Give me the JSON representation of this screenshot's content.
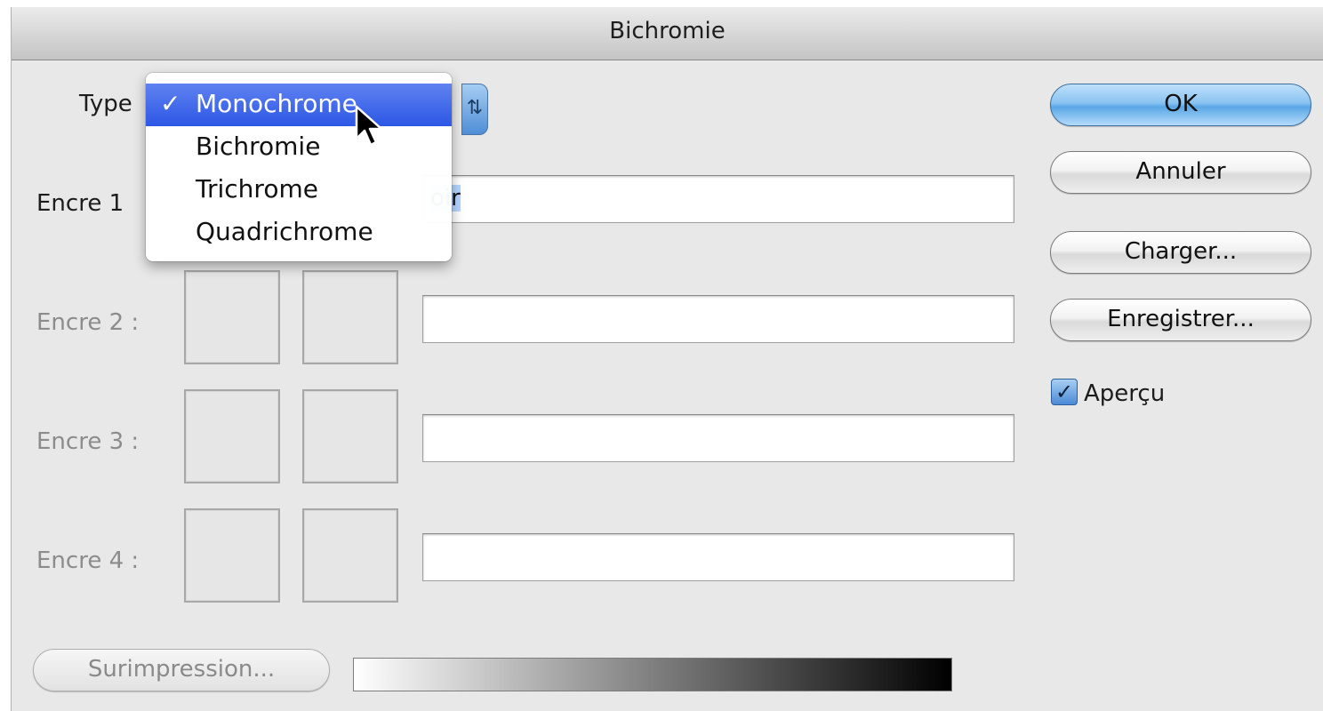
{
  "window": {
    "title": "Bichromie"
  },
  "type_field": {
    "label": "Type",
    "options": [
      "Monochrome",
      "Bichromie",
      "Trichrome",
      "Quadrichrome"
    ],
    "selected": "Monochrome",
    "check_mark": "✓",
    "stepper_symbol": "⇅"
  },
  "inks": [
    {
      "label": "Encre 1",
      "value_visible": "oir",
      "enabled": true
    },
    {
      "label": "Encre 2 :",
      "value_visible": "",
      "enabled": false
    },
    {
      "label": "Encre 3 :",
      "value_visible": "",
      "enabled": false
    },
    {
      "label": "Encre 4 :",
      "value_visible": "",
      "enabled": false
    }
  ],
  "buttons": {
    "ok": "OK",
    "cancel": "Annuler",
    "load": "Charger...",
    "save": "Enregistrer...",
    "overprint": "Surimpression..."
  },
  "preview": {
    "label": "Aperçu",
    "checked": true,
    "check_glyph": "✓"
  },
  "colors": {
    "accent": "#3d6de6",
    "default_button": "#6aaee9",
    "dialog_bg": "#e8e8e8"
  },
  "icons": {
    "cursor": "arrow-cursor-icon",
    "stepper": "up-down-arrows-icon",
    "checkmark": "checkmark-icon"
  }
}
